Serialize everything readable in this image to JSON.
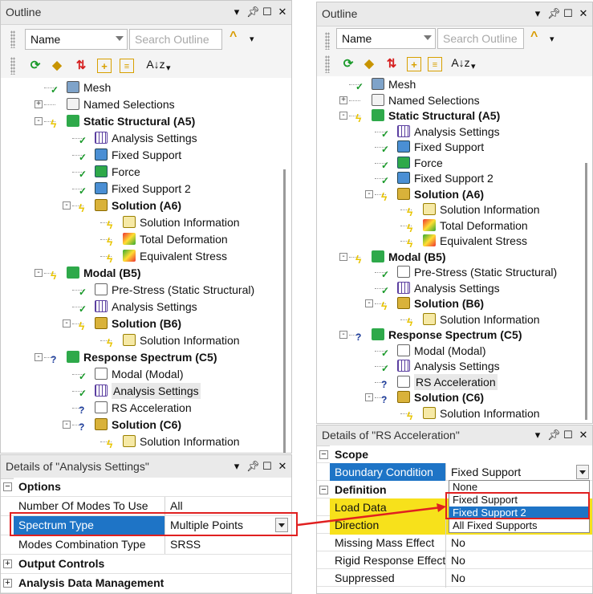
{
  "left": {
    "outline_title": "Outline",
    "name_combo": "Name",
    "search_placeholder": "Search Outline",
    "sort_label": "A↓z",
    "tree": [
      {
        "label": "Mesh",
        "bold": false
      },
      {
        "label": "Named Selections",
        "bold": false
      },
      {
        "label": "Static Structural (A5)",
        "bold": true
      },
      {
        "label": "Analysis Settings",
        "bold": false
      },
      {
        "label": "Fixed Support",
        "bold": false
      },
      {
        "label": "Force",
        "bold": false
      },
      {
        "label": "Fixed Support 2",
        "bold": false
      },
      {
        "label": "Solution (A6)",
        "bold": true
      },
      {
        "label": "Solution Information",
        "bold": false
      },
      {
        "label": "Total Deformation",
        "bold": false
      },
      {
        "label": "Equivalent Stress",
        "bold": false
      },
      {
        "label": "Modal (B5)",
        "bold": true
      },
      {
        "label": "Pre-Stress (Static Structural)",
        "bold": false
      },
      {
        "label": "Analysis Settings",
        "bold": false
      },
      {
        "label": "Solution (B6)",
        "bold": true
      },
      {
        "label": "Solution Information",
        "bold": false
      },
      {
        "label": "Response Spectrum (C5)",
        "bold": true
      },
      {
        "label": "Modal (Modal)",
        "bold": false
      },
      {
        "label": "Analysis Settings",
        "bold": false
      },
      {
        "label": "RS Acceleration",
        "bold": false
      },
      {
        "label": "Solution (C6)",
        "bold": true
      },
      {
        "label": "Solution Information",
        "bold": false
      }
    ],
    "details_title": "Details of \"Analysis Settings\"",
    "details": [
      {
        "key": "Options",
        "section": true
      },
      {
        "key": "Number Of Modes To Use",
        "value": "All"
      },
      {
        "key": "Spectrum Type",
        "value": "Multiple Points"
      },
      {
        "key": "Modes Combination Type",
        "value": "SRSS"
      },
      {
        "key": "Output Controls",
        "section": true
      },
      {
        "key": "Analysis Data Management",
        "section": true
      }
    ]
  },
  "right": {
    "outline_title": "Outline",
    "name_combo": "Name",
    "search_placeholder": "Search Outline",
    "sort_label": "A↓z",
    "tree": [
      {
        "label": "Mesh",
        "bold": false
      },
      {
        "label": "Named Selections",
        "bold": false
      },
      {
        "label": "Static Structural (A5)",
        "bold": true
      },
      {
        "label": "Analysis Settings",
        "bold": false
      },
      {
        "label": "Fixed Support",
        "bold": false
      },
      {
        "label": "Force",
        "bold": false
      },
      {
        "label": "Fixed Support 2",
        "bold": false
      },
      {
        "label": "Solution (A6)",
        "bold": true
      },
      {
        "label": "Solution Information",
        "bold": false
      },
      {
        "label": "Total Deformation",
        "bold": false
      },
      {
        "label": "Equivalent Stress",
        "bold": false
      },
      {
        "label": "Modal (B5)",
        "bold": true
      },
      {
        "label": "Pre-Stress (Static Structural)",
        "bold": false
      },
      {
        "label": "Analysis Settings",
        "bold": false
      },
      {
        "label": "Solution (B6)",
        "bold": true
      },
      {
        "label": "Solution Information",
        "bold": false
      },
      {
        "label": "Response Spectrum (C5)",
        "bold": true
      },
      {
        "label": "Modal (Modal)",
        "bold": false
      },
      {
        "label": "Analysis Settings",
        "bold": false
      },
      {
        "label": "RS Acceleration",
        "bold": false
      },
      {
        "label": "Solution (C6)",
        "bold": true
      },
      {
        "label": "Solution Information",
        "bold": false
      }
    ],
    "details_title": "Details of \"RS Acceleration\"",
    "details": [
      {
        "key": "Scope",
        "section": true
      },
      {
        "key": "Boundary Condition",
        "value": "Fixed Support"
      },
      {
        "key": "Definition",
        "section": true
      },
      {
        "key": "Load Data",
        "value": ""
      },
      {
        "key": "Direction",
        "value": ""
      },
      {
        "key": "Missing Mass Effect",
        "value": "No"
      },
      {
        "key": "Rigid Response Effect",
        "value": "No"
      },
      {
        "key": "Suppressed",
        "value": "No"
      }
    ],
    "dropdown_options": [
      "None",
      "Fixed Support",
      "Fixed Support 2",
      "All Fixed Supports"
    ],
    "dropdown_highlighted": "Fixed Support 2"
  },
  "colors": {
    "selection": "#1e74c6",
    "highlight_yellow": "#f7e11b",
    "annotation_red": "#e02020",
    "check_green": "#1a9a2a",
    "lightning": "#e8c400"
  }
}
